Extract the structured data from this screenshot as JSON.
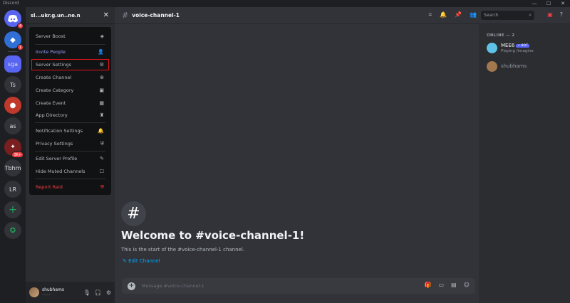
{
  "window": {
    "title": "Discord",
    "controls": [
      "—",
      "☐",
      "✕"
    ]
  },
  "rail": {
    "items": [
      {
        "label": "",
        "icon": "discord-icon",
        "badge": "4"
      },
      {
        "label": "",
        "icon": "game-icon",
        "badge": "1"
      },
      {
        "label": "sga",
        "badge": ""
      },
      {
        "label": "Ts",
        "badge": ""
      },
      {
        "label": "",
        "icon": "among-us-icon",
        "badge": ""
      },
      {
        "label": "as",
        "badge": ""
      },
      {
        "label": "",
        "icon": "game-avatar-icon",
        "badge": "3K+"
      },
      {
        "label": "Tbhm",
        "badge": ""
      },
      {
        "label": "LR",
        "badge": ""
      }
    ],
    "add_label": "+",
    "explore_label": "✪"
  },
  "server": {
    "name": "sl...ukr.g.un..ne.n",
    "close_glyph": "✕"
  },
  "menu": {
    "items": [
      {
        "label": "Server Boost",
        "icon": "◈",
        "style": "boost"
      },
      {
        "label": "Invite People",
        "icon": "👤",
        "style": "invite"
      },
      {
        "label": "Server Settings",
        "icon": "⚙",
        "style": "hl"
      },
      {
        "label": "Create Channel",
        "icon": "⊕",
        "style": ""
      },
      {
        "label": "Create Category",
        "icon": "▣",
        "style": ""
      },
      {
        "label": "Create Event",
        "icon": "▦",
        "style": ""
      },
      {
        "label": "App Directory",
        "icon": "♜",
        "style": ""
      },
      {
        "label": "Notification Settings",
        "icon": "🔔",
        "style": ""
      },
      {
        "label": "Privacy Settings",
        "icon": "⛨",
        "style": ""
      },
      {
        "label": "Edit Server Profile",
        "icon": "✎",
        "style": ""
      },
      {
        "label": "Hide Muted Channels",
        "icon": "☐",
        "style": ""
      },
      {
        "label": "Report Raid",
        "icon": "⛨",
        "style": "danger"
      }
    ]
  },
  "user": {
    "name": "shubhams",
    "status": "...,...."
  },
  "channel": {
    "hash": "#",
    "name": "voice-channel-1"
  },
  "search": {
    "placeholder": "Search"
  },
  "welcome": {
    "icon": "#",
    "title": "Welcome to #voice-channel-1!",
    "subtitle": "This is the start of the #voice-channel-1 channel.",
    "edit_label": "✎ Edit Channel"
  },
  "composer": {
    "placeholder": "Message #voice-channel-1"
  },
  "members": {
    "header": "ONLINE — 2",
    "list": [
      {
        "name": "MEE6",
        "bot": "✓ BOT",
        "status": "Playing /imagine",
        "color": "#5ec2e6"
      },
      {
        "name": "shubhams",
        "bot": "",
        "status": "",
        "color": "#a3784f"
      }
    ]
  },
  "colors": {
    "accent": "#5865f2",
    "danger": "#f23f43",
    "highlight_box": "#e0151a"
  }
}
